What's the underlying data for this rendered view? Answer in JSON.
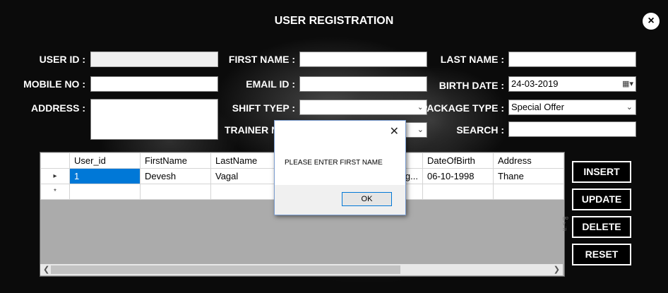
{
  "window": {
    "title": "USER REGISTRATION",
    "close_glyph": "×"
  },
  "form": {
    "user_id_label": "USER ID :",
    "user_id_value": "",
    "mobile_label": "MOBILE NO :",
    "mobile_value": "",
    "address_label": "ADDRESS :",
    "address_value": "",
    "first_name_label": "FIRST NAME :",
    "first_name_value": "",
    "email_label": "EMAIL ID :",
    "email_value": "",
    "shift_label": "SHIFT TYEP :",
    "shift_value": "",
    "trainer_label": "TRAINER NA",
    "trainer_value": "",
    "last_name_label": "LAST NAME :",
    "last_name_value": "",
    "birth_label": "BIRTH DATE :",
    "birth_value": "24-03-2019",
    "package_label": "PACKAGE TYPE :",
    "package_value": "Special Offer",
    "search_label": "SEARCH :",
    "search_value": ""
  },
  "grid": {
    "columns": [
      "User_id",
      "FirstName",
      "LastName",
      "",
      "DateOfBirth",
      "Address"
    ],
    "rows": [
      [
        "1",
        "Devesh",
        "Vagal",
        "g...",
        "06-10-1998",
        "Thane"
      ]
    ],
    "row_marker": "▸",
    "new_row_marker": "*"
  },
  "buttons": {
    "insert": "INSERT",
    "update": "UPDATE",
    "delete": "DELETE",
    "reset": "RESET"
  },
  "dialog": {
    "message": "PLEASE ENTER FIRST NAME",
    "ok_label": "OK",
    "close_glyph": "✕"
  },
  "icons": {
    "combo_arrow": "chevron-down-icon",
    "calendar": "calendar-icon"
  }
}
